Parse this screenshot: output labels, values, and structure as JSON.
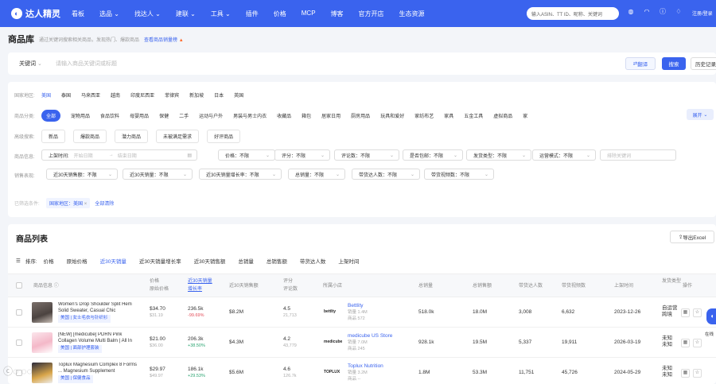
{
  "topnav": {
    "brand": "达人精灵",
    "items": [
      "看板",
      "选品",
      "找达人",
      "建联",
      "工具",
      "插件",
      "价格",
      "MCP",
      "博客",
      "官方开店",
      "生态资源"
    ],
    "search_placeholder": "输入ASIN、TT ID、昵称、关键词",
    "login": "注册/登录",
    "accent": "#3a63ee"
  },
  "page": {
    "title": "商品库",
    "desc": "通过关键词搜索相关商品，发现热门、爆款商品",
    "link": "查看商品销量榜"
  },
  "search": {
    "keyword_label": "关键词",
    "placeholder": "请输入商品关键词或标题",
    "translate": "翻译",
    "search": "搜索",
    "history": "历史记录"
  },
  "filters": {
    "country_label": "国家地区:",
    "countries": [
      "美国",
      "泰国",
      "马来西亚",
      "越南",
      "印度尼西亚",
      "菲律宾",
      "新加坡",
      "日本",
      "英国"
    ],
    "category_label": "商品分类:",
    "categories": [
      "全部",
      "宠物用品",
      "食品饮料",
      "母婴用品",
      "保健",
      "二手",
      "运动与户外",
      "男装与男士内衣",
      "收藏品",
      "箱包",
      "居家日用",
      "厨房用品",
      "玩具和爱好",
      "家纺布艺",
      "家具",
      "五金工具",
      "虚拟商品",
      "家"
    ],
    "expand": "展开",
    "tags_label": "高级搜索:",
    "tags": [
      "新品",
      "爆款商品",
      "潜力商品",
      "未被满足需求",
      "好评商品"
    ],
    "info_label": "商品信息:",
    "date_label": "上架时间:",
    "date_start": "开始日期",
    "date_sep": "→",
    "date_end": "结束日期",
    "dd_price": "价格：不限",
    "dd_score": "评分：不限",
    "dd_reviews": "评论数：不限",
    "dd_freeship": "是否包邮：不限",
    "dd_shiptype": "发货类型：不限",
    "dd_opmode": "运营模式：不限",
    "exclude_placeholder": "排除关键词",
    "sales_label": "销售表现:",
    "dd_sales30": "近30天销售额：不限",
    "dd_vol30": "近30天销量：不限",
    "dd_growth30": "近30天销量增长率：不限",
    "dd_total": "总销量：不限",
    "dd_creators": "带货达人数：不限",
    "dd_videos": "带货视频数：不限",
    "applied_label": "已筛选条件:",
    "applied_tag": "国家地区：美国",
    "clear_all": "全部清除"
  },
  "list": {
    "title": "商品列表",
    "export": "导出Excel",
    "sort_label": "排序:",
    "sort_items": [
      "价格",
      "原始价格",
      "近30天销量",
      "近30天销量增长率",
      "近30天销售额",
      "总销量",
      "总销售额",
      "带货达人数",
      "上架时间"
    ],
    "headers": {
      "product": "商品信息",
      "price": "价格",
      "orig_price": "原始价格",
      "vol30": "近30天销量",
      "growth": "增长率",
      "sales30": "近30天销售额",
      "score": "评分",
      "reviews": "评论数",
      "shop": "所属小店",
      "total_vol": "总销量",
      "total_sales": "总销售额",
      "creators": "带货达人数",
      "videos": "带货视频数",
      "listed": "上架时间",
      "shipping": "发货类型",
      "op": "操作"
    },
    "rows": [
      {
        "name": "Women's Drop Shoulder Split Hem Solid Sweater, Casual Chic Aesthetic...",
        "tag": "美国 | 女士毛衣与针织衫",
        "price": "$34.70",
        "orig": "$31.19",
        "vol30": "236.5k",
        "growth": "-99.69%",
        "sales30": "$8.2M",
        "score": "4.5",
        "reviews": "21,713",
        "shop_logo": "bettlty",
        "shop": "Bettlity",
        "shop_sales": "销量 1.4M",
        "shop_items": "商品 572",
        "total_vol": "518.0k",
        "total_sales": "18.0M",
        "creators": "3,008",
        "videos": "6,632",
        "listed": "2023-12-26",
        "ship1": "自运营",
        "ship2": "跨境"
      },
      {
        "name": "[NEW] [medicube] PDRN Pink Collagen Volume Multi Balm | All In One-...",
        "tag": "美国 | 面部护理套装",
        "price": "$21.00",
        "orig": "$36.00",
        "vol30": "206.3k",
        "growth": "+38.50%",
        "sales30": "$4.3M",
        "score": "4.2",
        "reviews": "43,779",
        "shop_logo": "medicube",
        "shop": "medicube US Store",
        "shop_sales": "销量 7.0M",
        "shop_items": "商品 245",
        "total_vol": "928.1k",
        "total_sales": "19.5M",
        "creators": "5,337",
        "videos": "19,911",
        "listed": "2026-03-19",
        "ship1": "未知",
        "ship2": "未知"
      },
      {
        "name": "Toplux Magnesium Complex 8 Forms ... Magnesium Supplement",
        "tag": "美国 | 保健食品",
        "price": "$29.97",
        "orig": "$49.97",
        "vol30": "186.1k",
        "growth": "+29.53%",
        "sales30": "$5.6M",
        "score": "4.6",
        "reviews": "126.7k",
        "shop_logo": "TOPLUX",
        "shop": "Toplux Nutrition",
        "shop_sales": "销量 3.2M",
        "shop_items": "商品 --",
        "total_vol": "1.8M",
        "total_sales": "53.3M",
        "creators": "11,751",
        "videos": "45,726",
        "listed": "2024-05-29",
        "ship1": "未知",
        "ship2": "未知"
      }
    ]
  },
  "float_label": "在线"
}
